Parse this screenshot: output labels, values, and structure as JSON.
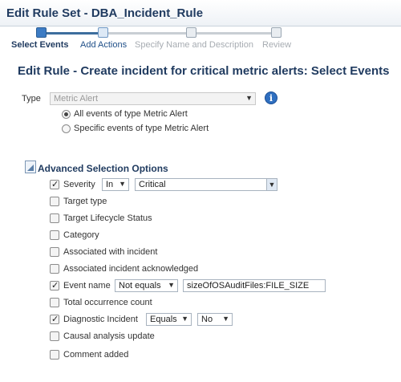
{
  "window": {
    "title": "Edit Rule Set - DBA_Incident_Rule"
  },
  "train": {
    "steps": [
      {
        "label": "Select Events"
      },
      {
        "label": "Add Actions"
      },
      {
        "label": "Specify Name and Description"
      },
      {
        "label": "Review"
      }
    ]
  },
  "heading": "Edit Rule - Create incident for critical metric alerts: Select Events",
  "type_field": {
    "label": "Type",
    "value": "Metric Alert"
  },
  "radios": [
    {
      "label": "All events of type Metric Alert",
      "selected": true
    },
    {
      "label": "Specific events of type Metric Alert",
      "selected": false
    }
  ],
  "advanced": {
    "title": "Advanced Selection Options",
    "options": [
      {
        "label": "Severity",
        "checked": true,
        "operator": "In",
        "value": "Critical"
      },
      {
        "label": "Target type",
        "checked": false
      },
      {
        "label": "Target Lifecycle Status",
        "checked": false
      },
      {
        "label": "Category",
        "checked": false
      },
      {
        "label": "Associated with incident",
        "checked": false
      },
      {
        "label": "Associated incident acknowledged",
        "checked": false
      },
      {
        "label": "Event name",
        "checked": true,
        "operator": "Not equals",
        "value": "sizeOfOSAuditFiles:FILE_SIZE"
      },
      {
        "label": "Total occurrence count",
        "checked": false
      },
      {
        "label": "Diagnostic Incident",
        "checked": true,
        "operator": "Equals",
        "value": "No"
      },
      {
        "label": "Causal analysis update",
        "checked": false
      },
      {
        "label": "Comment added",
        "checked": false
      }
    ]
  },
  "colors": {
    "accent": "#1f3a5f",
    "link": "#1f4f88",
    "active_step": "#3d7cc4"
  }
}
